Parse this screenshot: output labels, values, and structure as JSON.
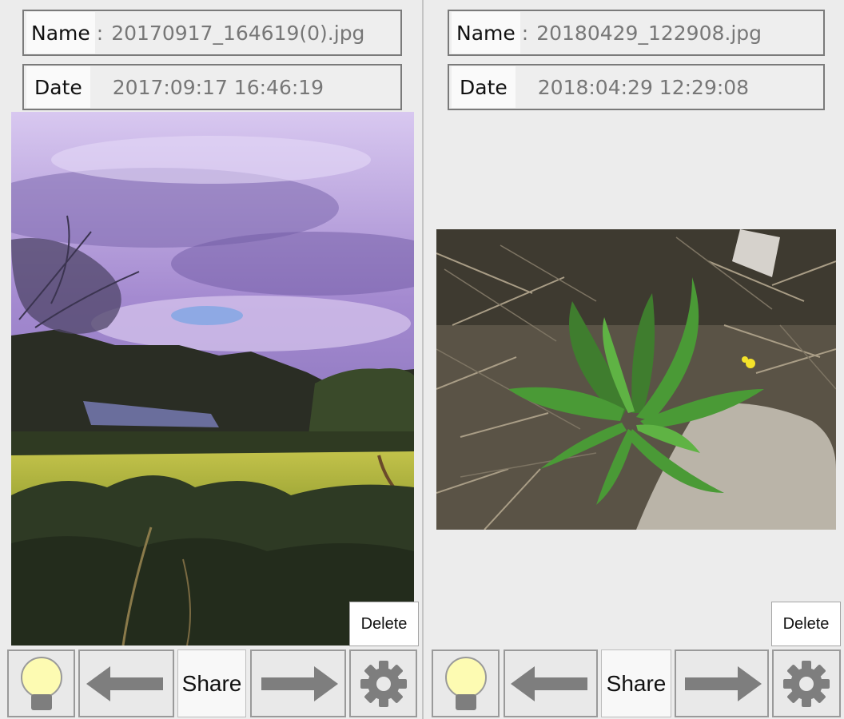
{
  "left_panel": {
    "name_label": "Name",
    "name_separator": ":",
    "name_value": "20170917_164619(0).jpg",
    "date_label": "Date",
    "date_value": "2017:09:17 16:46:19",
    "delete_label": "Delete",
    "share_label": "Share",
    "icons": [
      "lightbulb-icon",
      "arrow-left-icon",
      "arrow-right-icon",
      "gear-icon"
    ]
  },
  "right_panel": {
    "name_label": "Name",
    "name_separator": ":",
    "name_value": "20180429_122908.jpg",
    "date_label": "Date",
    "date_value": "2018:04:29 12:29:08",
    "delete_label": "Delete",
    "share_label": "Share",
    "icons": [
      "lightbulb-icon",
      "arrow-left-icon",
      "arrow-right-icon",
      "gear-icon"
    ]
  },
  "colors": {
    "background": "#ececec",
    "bulb": "#fdfbb2",
    "icon_gray": "#8a8a8a"
  }
}
